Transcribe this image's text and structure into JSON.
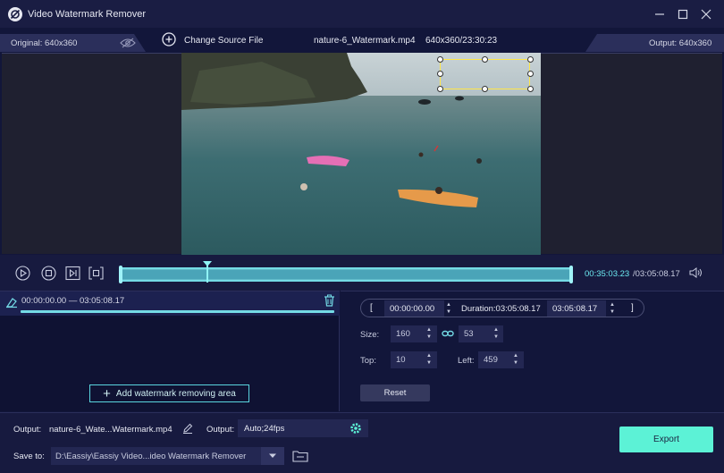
{
  "window": {
    "title": "Video Watermark Remover",
    "minimize_icon": "minimize-icon",
    "maximize_icon": "maximize-icon",
    "close_icon": "close-icon"
  },
  "info": {
    "original_label": "Original: 640x360",
    "change_source_label": "Change Source File",
    "file_name": "nature-6_Watermark.mp4",
    "file_info": "640x360/23:30:23",
    "output_label": "Output: 640x360"
  },
  "playback": {
    "current_time": "00:35:03.23",
    "total_time": "/03:05:08.17",
    "progress": 0.19
  },
  "segment": {
    "time_range": "00:00:00.00 — 03:05:08.17"
  },
  "add_area_label": "Add watermark removing area",
  "range": {
    "open_bracket": "[",
    "start": "00:00:00.00",
    "duration": "Duration:03:05:08.17",
    "end": "03:05:08.17",
    "close_bracket": "]"
  },
  "params": {
    "size_label": "Size:",
    "width": "160",
    "height": "53",
    "top_label": "Top:",
    "top": "10",
    "left_label": "Left:",
    "left": "459"
  },
  "reset_label": "Reset",
  "bottom": {
    "output_label": "Output:",
    "output_file": "nature-6_Wate...Watermark.mp4",
    "output_format_label": "Output:",
    "output_format": "Auto;24fps",
    "save_to_label": "Save to:",
    "save_path": "D:\\Eassiy\\Eassiy Video...ideo Watermark Remover",
    "export_label": "Export"
  },
  "colors": {
    "accent": "#5cf2d6",
    "timeline": "#74dbe6",
    "selection": "#ffe64a",
    "background": "#12163a"
  }
}
